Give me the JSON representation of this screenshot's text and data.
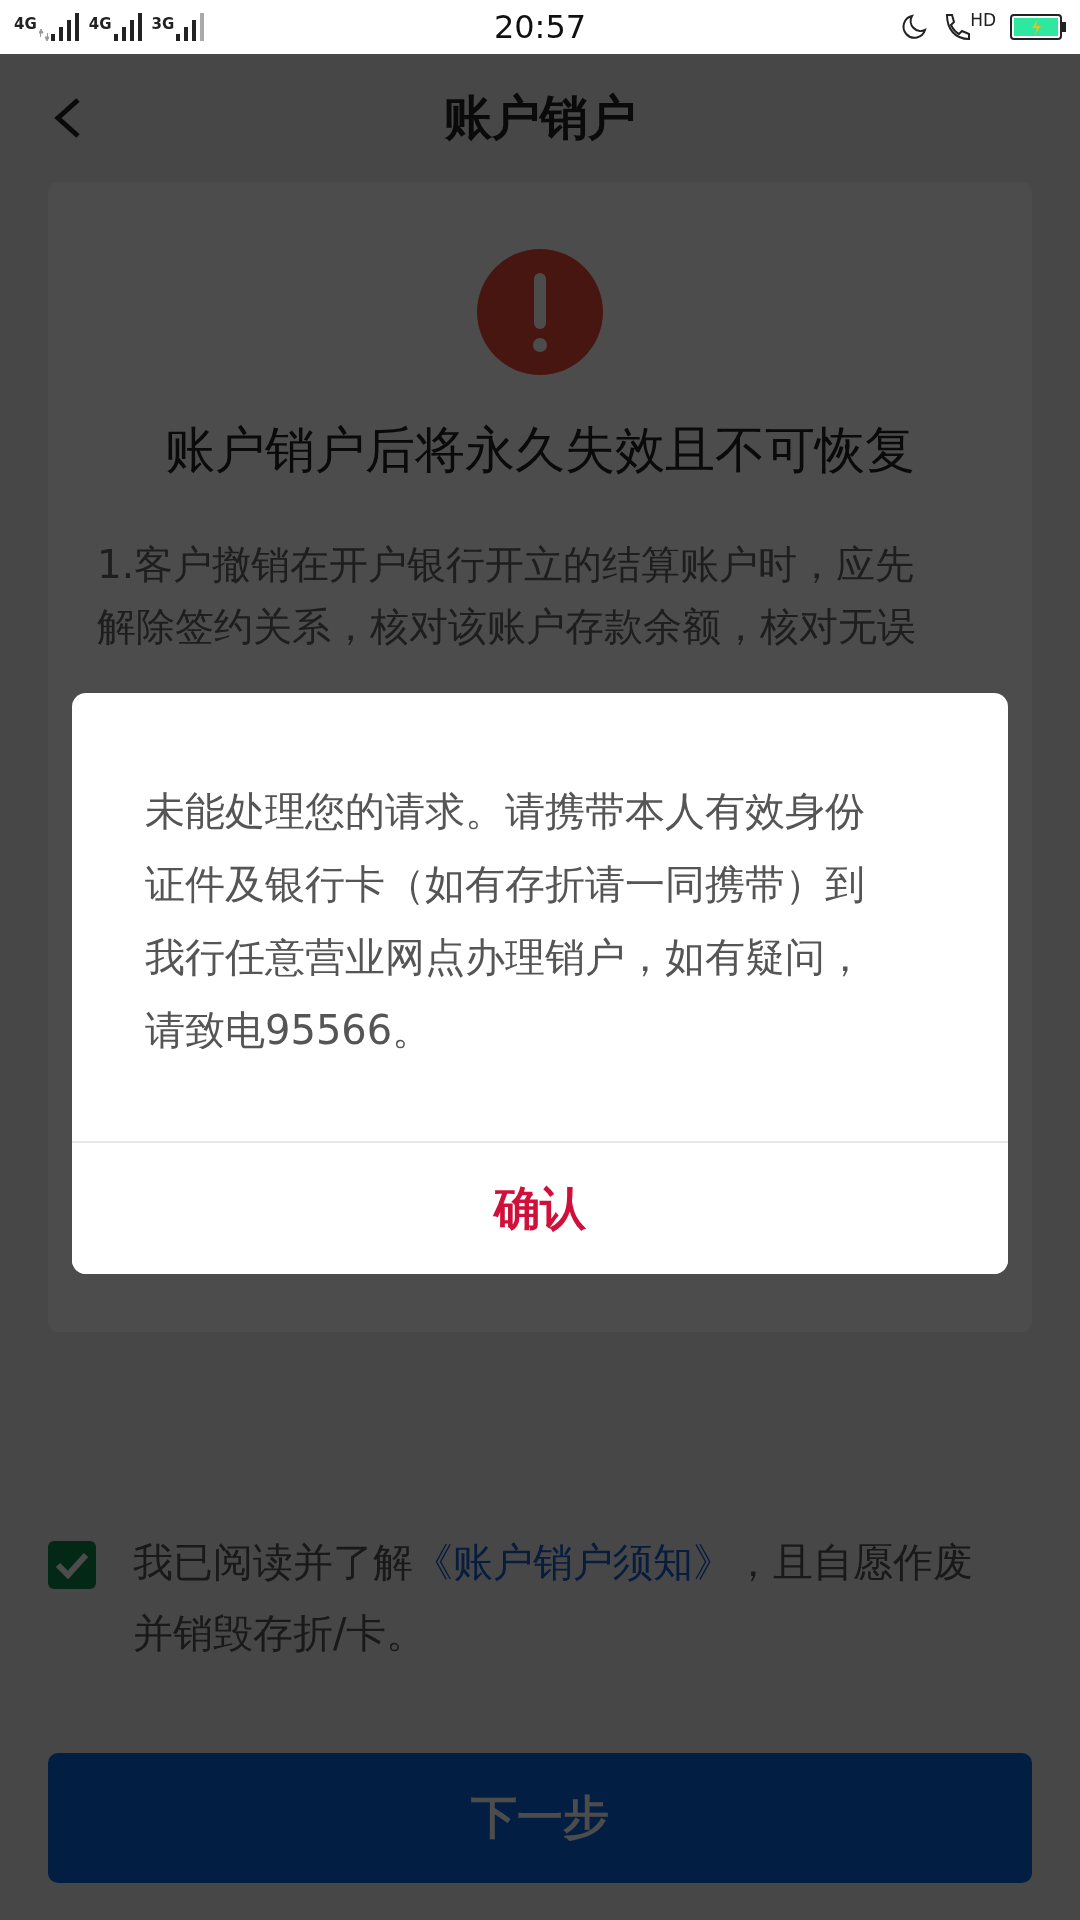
{
  "status_bar": {
    "networks": [
      {
        "label": "4G",
        "arrows": true
      },
      {
        "label": "4G",
        "arrows": false
      },
      {
        "label": "3G",
        "arrows": false
      }
    ],
    "time": "20:57",
    "call_label": "HD",
    "charging": true
  },
  "header": {
    "title": "账户销户"
  },
  "warning": {
    "heading": "账户销户后将永久失效且不可恢复",
    "notice_lines": [
      "1.客户撤销在开户银行开立的结算账户时，应先",
      "解除签约关系，核对该账户存款余额，核对无误"
    ]
  },
  "agreement": {
    "checked": true,
    "text_before": "我已阅读并了解",
    "link": "《账户销户须知》",
    "text_after": "，且自愿作废并销毁存折/卡。"
  },
  "next_button": {
    "label": "下一步"
  },
  "dialog": {
    "message": "未能处理您的请求。请携带本人有效身份证件及银行卡（如有存折请一同携带）到我行任意营业网点办理销户，如有疑问，请致电95566。",
    "confirm": "确认"
  }
}
